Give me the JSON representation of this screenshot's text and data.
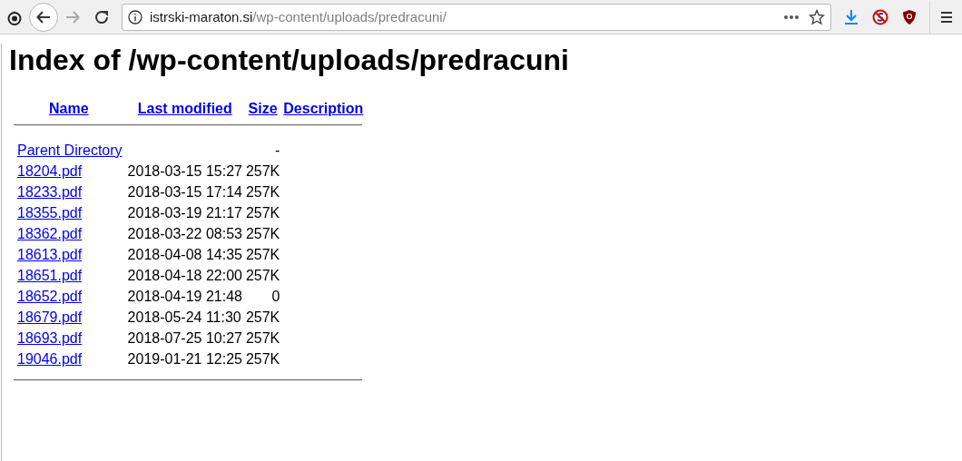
{
  "browser": {
    "url_host": "istrski-maraton.si",
    "url_path": "/wp-content/uploads/predracuni/",
    "forward_disabled": true
  },
  "page": {
    "title": "Index of /wp-content/uploads/predracuni",
    "columns": [
      "Name",
      "Last modified",
      "Size",
      "Description"
    ],
    "rows": [
      {
        "name": "Parent Directory",
        "modified": "",
        "size": "-"
      },
      {
        "name": "18204.pdf",
        "modified": "2018-03-15 15:27",
        "size": "257K"
      },
      {
        "name": "18233.pdf",
        "modified": "2018-03-15 17:14",
        "size": "257K"
      },
      {
        "name": "18355.pdf",
        "modified": "2018-03-19 21:17",
        "size": "257K"
      },
      {
        "name": "18362.pdf",
        "modified": "2018-03-22 08:53",
        "size": "257K"
      },
      {
        "name": "18613.pdf",
        "modified": "2018-04-08 14:35",
        "size": "257K"
      },
      {
        "name": "18651.pdf",
        "modified": "2018-04-18 22:00",
        "size": "257K"
      },
      {
        "name": "18652.pdf",
        "modified": "2018-04-19 21:48",
        "size": "0"
      },
      {
        "name": "18679.pdf",
        "modified": "2018-05-24 11:30",
        "size": "257K"
      },
      {
        "name": "18693.pdf",
        "modified": "2018-07-25 10:27",
        "size": "257K"
      },
      {
        "name": "19046.pdf",
        "modified": "2019-01-21 12:25",
        "size": "257K"
      }
    ]
  }
}
